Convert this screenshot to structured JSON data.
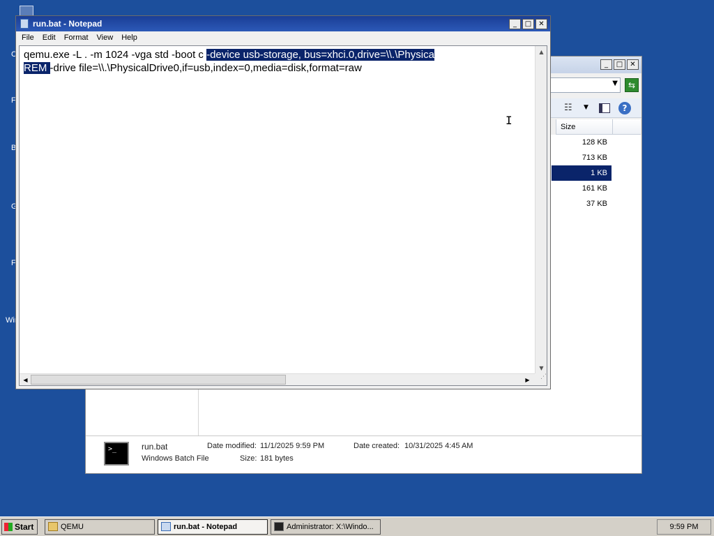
{
  "desktop": {
    "side_letters": [
      "C",
      "F",
      "B",
      "G",
      "F",
      "Win"
    ]
  },
  "explorer": {
    "size_header": "Size",
    "sizes": [
      "128 KB",
      "713 KB",
      "1 KB",
      "161 KB",
      "37 KB"
    ],
    "selected_index": 2,
    "details": {
      "file_name": "run.bat",
      "file_type": "Windows Batch File",
      "modified_label": "Date modified:",
      "modified_value": "11/1/2025 9:59 PM",
      "created_label": "Date created:",
      "created_value": "10/31/2025 4:45 AM",
      "size_label": "Size:",
      "size_value": "181 bytes"
    }
  },
  "notepad": {
    "title": "run.bat - Notepad",
    "menu": [
      "File",
      "Edit",
      "Format",
      "View",
      "Help"
    ],
    "line1_plain": "qemu.exe -L . -m 1024 -vga std -boot c ",
    "line1_selected": "-device usb-storage, bus=xhci.0,drive=\\\\.\\Physica",
    "line2_selected": "REM ",
    "line2_plain": "-drive file=\\\\.\\PhysicalDrive0,if=usb,index=0,media=disk,format=raw"
  },
  "taskbar": {
    "start_label": "Start",
    "tasks": [
      "QEMU",
      "run.bat - Notepad",
      "Administrator: X:\\Windo..."
    ],
    "active_task": 1,
    "clock": "9:59 PM"
  }
}
